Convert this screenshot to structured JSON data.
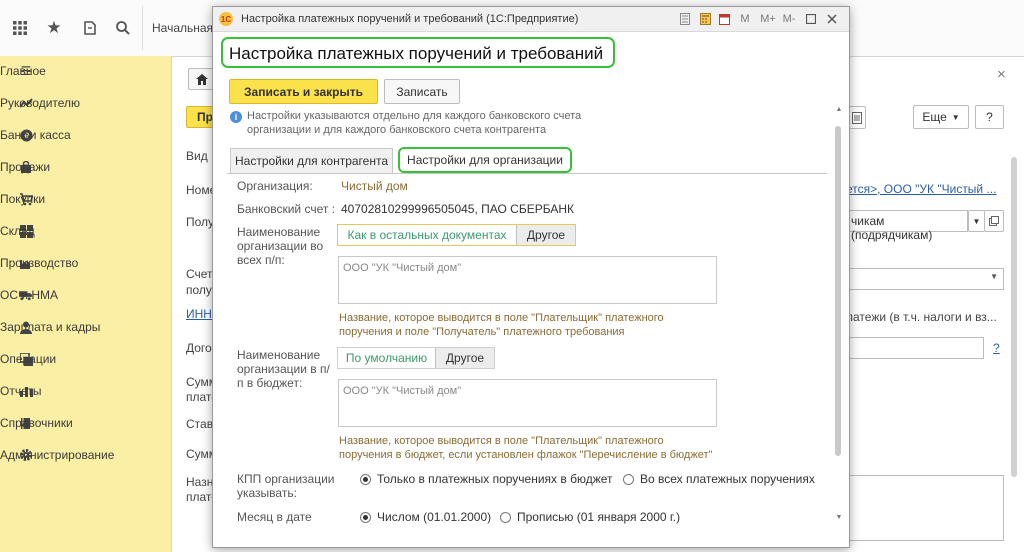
{
  "topbar": {
    "home_tab": "Начальная",
    "icons": [
      "apps-grid-icon",
      "star-icon",
      "history-icon",
      "search-icon"
    ]
  },
  "sidebar": {
    "items": [
      {
        "label": "Главное",
        "icon": "menu-icon"
      },
      {
        "label": "Руководителю",
        "icon": "chart-icon"
      },
      {
        "label": "Банк и касса",
        "icon": "coin-icon"
      },
      {
        "label": "Продажи",
        "icon": "bag-icon"
      },
      {
        "label": "Покупки",
        "icon": "cart-icon"
      },
      {
        "label": "Склад",
        "icon": "grid-icon"
      },
      {
        "label": "Производство",
        "icon": "factory-icon"
      },
      {
        "label": "ОС и НМА",
        "icon": "truck-icon"
      },
      {
        "label": "Зарплата и кадры",
        "icon": "person-icon"
      },
      {
        "label": "Операции",
        "icon": "operations-icon"
      },
      {
        "label": "Отчеты",
        "icon": "bar-chart-icon"
      },
      {
        "label": "Справочники",
        "icon": "book-icon"
      },
      {
        "label": "Администрирование",
        "icon": "gear-icon"
      }
    ]
  },
  "bgform": {
    "labels": [
      "Вид",
      "Номе",
      "Полу",
      "Счет",
      "полу",
      "ИНН",
      "Дого",
      "Сумм",
      "плате",
      "Став",
      "Сумм",
      "Назн",
      "плате"
    ],
    "link_right": "ется>, ООО \"УК \"Чистый ...",
    "select_right": "чикам (подрядчикам)",
    "payments_text": "латежи (в т.ч. налоги и вз...",
    "more_button": "Еще",
    "help_button": "?",
    "question_link": "?",
    "close_icon": "×",
    "create_button_partial": "Пр"
  },
  "dialog": {
    "window_title": "Настройка платежных поручений и требований (1С:Предприятие)",
    "heading": "Настройка платежных поручений и требований",
    "save_close_button": "Записать и закрыть",
    "save_button": "Записать",
    "info_text": "Настройки указываются отдельно для каждого банковского счета организации и для каждого банковского счета контрагента",
    "tabs": [
      {
        "label": "Настройки для контрагента",
        "active": false
      },
      {
        "label": "Настройки для организации",
        "active": true
      }
    ],
    "org_label": "Организация:",
    "org_value": "Чистый дом",
    "account_label": "Банковский счет :",
    "account_value": "40702810299996505045, ПАО СБЕРБАНК",
    "name_all_label": "Наименование организации во всех п/п:",
    "name_all_options": [
      "Как в остальных документах",
      "Другое"
    ],
    "name_all_text": "ООО \"УК \"Чистый дом\"",
    "name_all_hint": "Название, которое выводится в поле \"Плательщик\" платежного поручения и поле \"Получатель\" платежного требования",
    "name_budget_label": "Наименование организации в п/п в бюджет:",
    "name_budget_options": [
      "По умолчанию",
      "Другое"
    ],
    "name_budget_text": "ООО \"УК \"Чистый дом\"",
    "name_budget_hint": "Название, которое выводится в поле \"Плательщик\" платежного поручения в бюджет, если установлен флажок \"Перечисление в бюджет\"",
    "kpp_label": "КПП организации указывать:",
    "kpp_options": [
      {
        "label": "Только в платежных поручениях в бюджет",
        "selected": true
      },
      {
        "label": "Во всех платежных поручениях",
        "selected": false
      }
    ],
    "month_label": "Месяц в дате",
    "month_options": [
      {
        "label": "Числом (01.01.2000)",
        "selected": true
      },
      {
        "label": "Прописью (01 января 2000 г.)",
        "selected": false
      }
    ],
    "title_buttons": [
      "M",
      "M+",
      "M-"
    ]
  },
  "colors": {
    "sidebar_bg": "#fbeea5",
    "primary_button": "#fbe24b",
    "highlight_green": "#35c235",
    "hint_text": "#8a6b34",
    "link": "#2a5ea8"
  }
}
